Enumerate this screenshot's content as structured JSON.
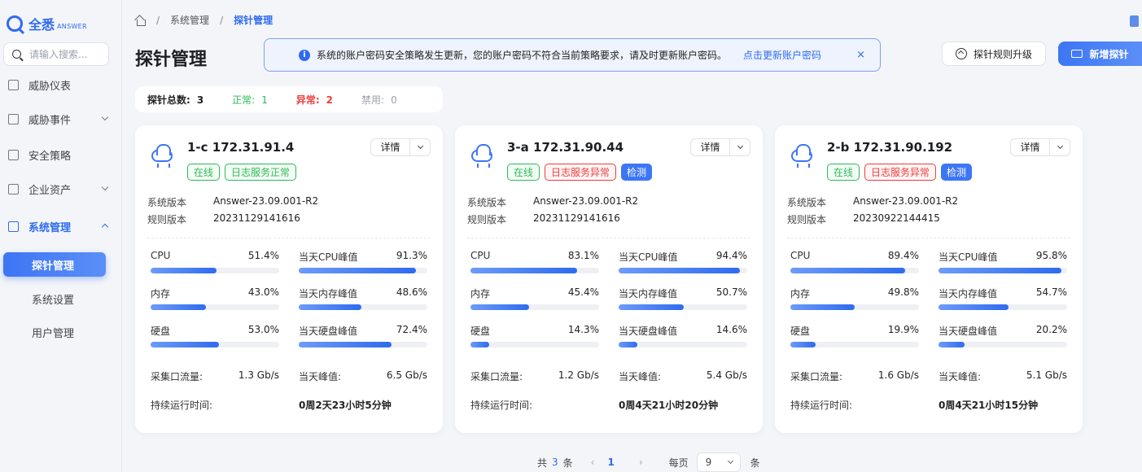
{
  "logo": {
    "cn": "全悉",
    "en": "ANSWER"
  },
  "search": {
    "placeholder": "请输入搜索..."
  },
  "nav": {
    "items": [
      {
        "label": "威胁仪表"
      },
      {
        "label": "威胁事件"
      },
      {
        "label": "安全策略"
      },
      {
        "label": "企业资产"
      },
      {
        "label": "系统管理"
      }
    ],
    "sub_items": [
      {
        "label": "探针管理"
      },
      {
        "label": "系统设置"
      },
      {
        "label": "用户管理"
      }
    ]
  },
  "breadcrumb": {
    "level1": "系统管理",
    "level2": "探针管理",
    "sep": "/"
  },
  "page_title": "探针管理",
  "alert": {
    "text": "系统的账户密码安全策略发生更新，您的账户密码不符合当前策略要求，请及时更新账户密码。",
    "link": "点击更新账户密码",
    "close": "×",
    "icon_char": "i"
  },
  "toolbar": {
    "upgrade_label": "探针规则升级",
    "add_label": "新增探针"
  },
  "summary": {
    "total_label": "探针总数:",
    "total": "3",
    "normal_label": "正常:",
    "normal": "1",
    "abnormal_label": "异常:",
    "abnormal": "2",
    "disabled_label": "禁用:",
    "disabled": "0"
  },
  "labels": {
    "sys_version": "系统版本",
    "rule_version": "规则版本",
    "cpu": "CPU",
    "cpu_peak": "当天CPU峰值",
    "mem": "内存",
    "mem_peak": "当天内存峰值",
    "disk": "硬盘",
    "disk_peak": "当天硬盘峰值",
    "traffic": "采集口流量:",
    "traffic_peak": "当天峰值:",
    "uptime": "持续运行时间:",
    "detail": "详情"
  },
  "cards": [
    {
      "title": "1-c 172.31.91.4",
      "tags": [
        {
          "text": "在线",
          "color": "green"
        },
        {
          "text": "日志服务正常",
          "color": "green"
        }
      ],
      "sys_version": "Answer-23.09.001-R2",
      "rule_version": "20231129141616",
      "cpu": "51.4%",
      "cpu_pct": 51.4,
      "cpu_peak": "91.3%",
      "cpu_peak_pct": 91.3,
      "mem": "43.0%",
      "mem_pct": 43.0,
      "mem_peak": "48.6%",
      "mem_peak_pct": 48.6,
      "disk": "53.0%",
      "disk_pct": 53.0,
      "disk_peak": "72.4%",
      "disk_peak_pct": 72.4,
      "traffic": "1.3 Gb/s",
      "traffic_peak": "6.5 Gb/s",
      "uptime": "0周2天23小时5分钟"
    },
    {
      "title": "3-a 172.31.90.44",
      "tags": [
        {
          "text": "在线",
          "color": "green"
        },
        {
          "text": "日志服务异常",
          "color": "red"
        },
        {
          "text": "检测",
          "color": "blue"
        }
      ],
      "sys_version": "Answer-23.09.001-R2",
      "rule_version": "20231129141616",
      "cpu": "83.1%",
      "cpu_pct": 83.1,
      "cpu_peak": "94.4%",
      "cpu_peak_pct": 94.4,
      "mem": "45.4%",
      "mem_pct": 45.4,
      "mem_peak": "50.7%",
      "mem_peak_pct": 50.7,
      "disk": "14.3%",
      "disk_pct": 14.3,
      "disk_peak": "14.6%",
      "disk_peak_pct": 14.6,
      "traffic": "1.2 Gb/s",
      "traffic_peak": "5.4 Gb/s",
      "uptime": "0周4天21小时20分钟"
    },
    {
      "title": "2-b 172.31.90.192",
      "tags": [
        {
          "text": "在线",
          "color": "green"
        },
        {
          "text": "日志服务异常",
          "color": "red"
        },
        {
          "text": "检测",
          "color": "blue"
        }
      ],
      "sys_version": "Answer-23.09.001-R2",
      "rule_version": "20230922144415",
      "cpu": "89.4%",
      "cpu_pct": 89.4,
      "cpu_peak": "95.8%",
      "cpu_peak_pct": 95.8,
      "mem": "49.8%",
      "mem_pct": 49.8,
      "mem_peak": "54.7%",
      "mem_peak_pct": 54.7,
      "disk": "19.9%",
      "disk_pct": 19.9,
      "disk_peak": "20.2%",
      "disk_peak_pct": 20.2,
      "traffic": "1.6 Gb/s",
      "traffic_peak": "5.1 Gb/s",
      "uptime": "0周4天21小时15分钟"
    }
  ],
  "pagination": {
    "total_prefix": "共",
    "total": "3",
    "total_suffix": "条",
    "prev": "‹",
    "current": "1",
    "next": "›",
    "per_page_label": "每页",
    "per_page": "9",
    "per_page_suffix": "条"
  },
  "colors": {
    "accent": "#2f6bf0",
    "success": "#2dbb55",
    "danger": "#ee3d3d"
  }
}
